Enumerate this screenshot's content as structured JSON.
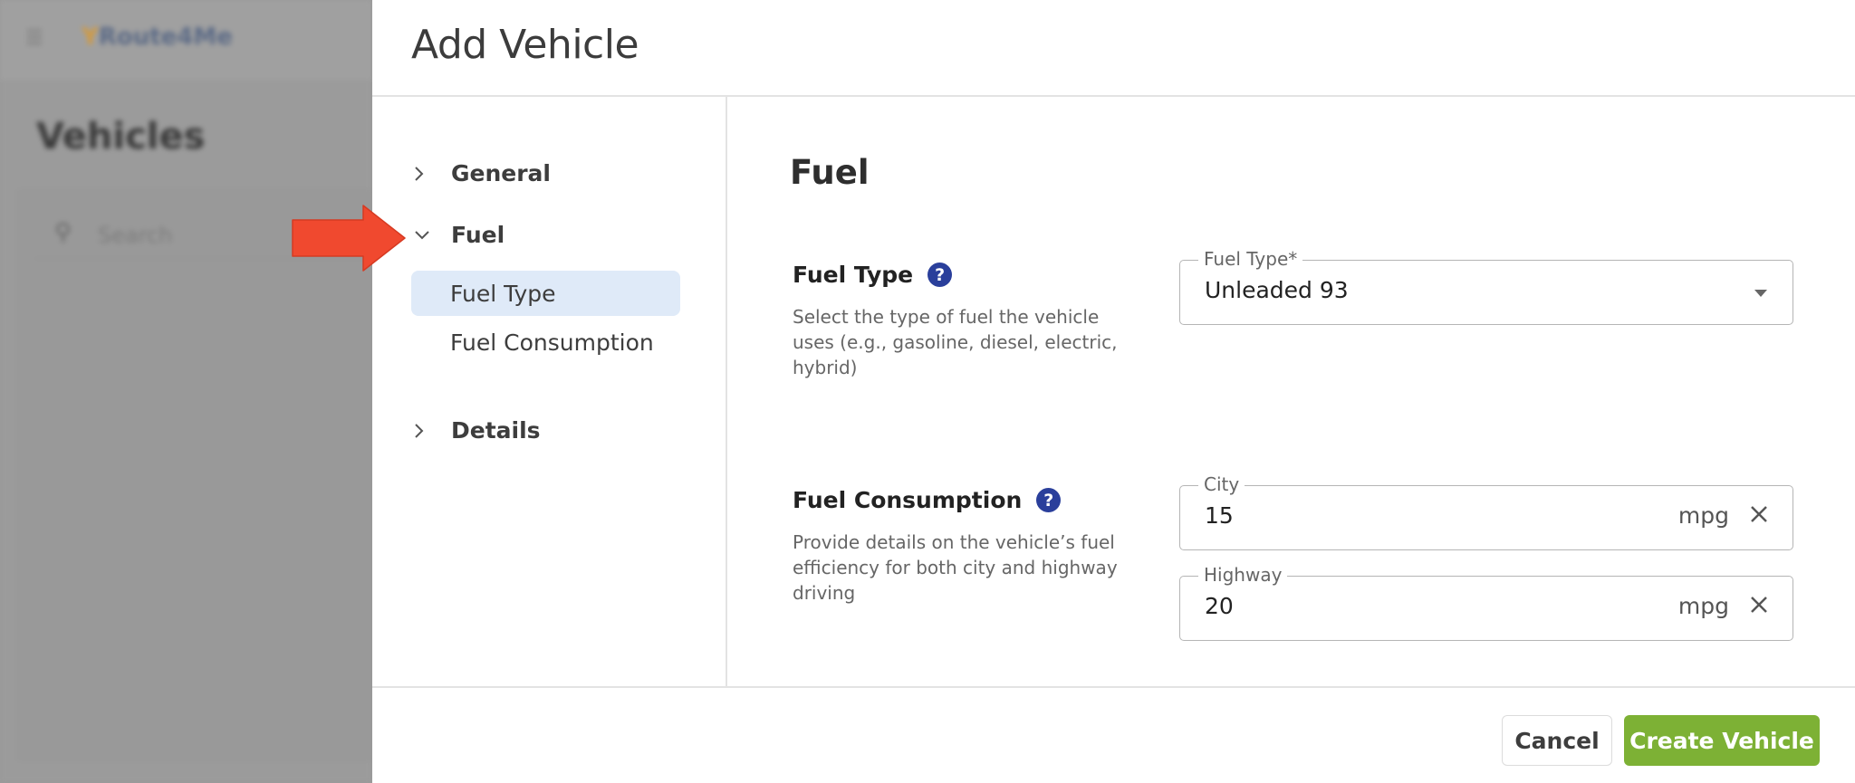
{
  "background": {
    "logo_text": "Route4Me",
    "page_title": "Vehicles",
    "search_placeholder": "Search"
  },
  "drawer": {
    "title": "Add Vehicle",
    "nav": {
      "groups": [
        {
          "label": "General",
          "expanded": false
        },
        {
          "label": "Fuel",
          "expanded": true,
          "items": [
            {
              "label": "Fuel Type",
              "active": true
            },
            {
              "label": "Fuel Consumption",
              "active": false
            }
          ]
        },
        {
          "label": "Details",
          "expanded": false
        }
      ]
    },
    "section": {
      "title": "Fuel",
      "fuel_type": {
        "label": "Fuel Type",
        "description": "Select the type of fuel the vehicle uses (e.g., gasoline, diesel, electric, hybrid)",
        "input_label": "Fuel Type*",
        "value": "Unleaded 93"
      },
      "fuel_consumption": {
        "label": "Fuel Consumption",
        "description": "Provide details on the vehicle’s fuel efficiency for both city and highway driving",
        "city": {
          "label": "City",
          "value": "15",
          "unit": "mpg"
        },
        "highway": {
          "label": "Highway",
          "value": "20",
          "unit": "mpg"
        }
      }
    },
    "footer": {
      "cancel_label": "Cancel",
      "create_label": "Create Vehicle"
    }
  },
  "colors": {
    "accent_green": "#7db135",
    "help_icon_blue": "#2a3f9b",
    "active_nav_bg": "#dfeaf8",
    "annotation_red": "#f0492f"
  }
}
